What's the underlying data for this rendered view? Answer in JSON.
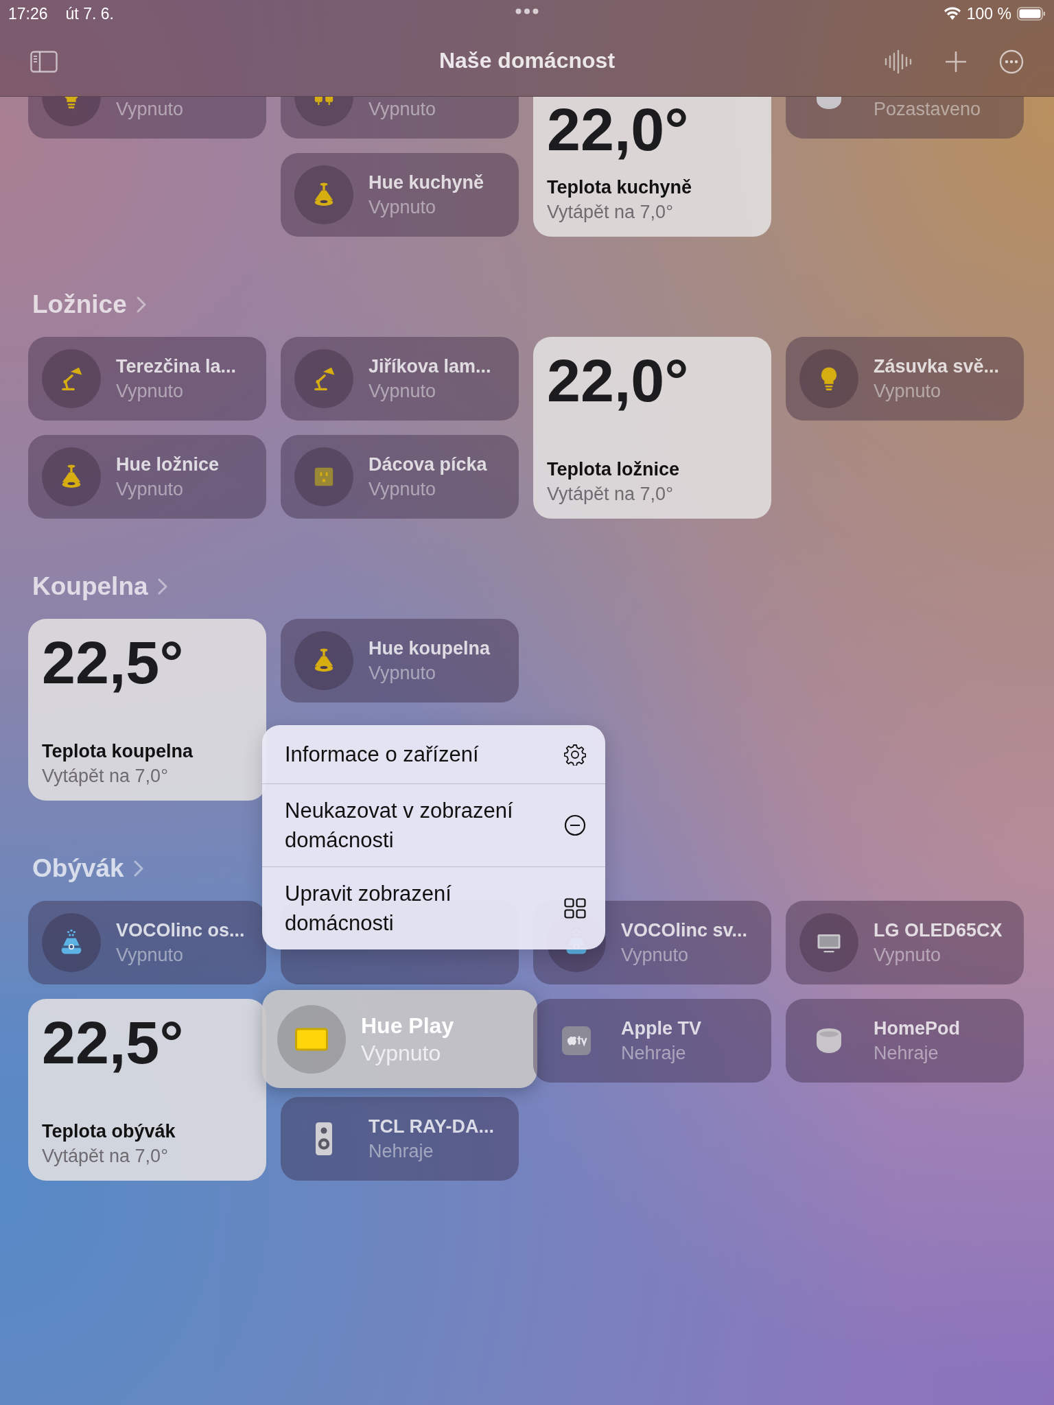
{
  "status_bar": {
    "time": "17:26",
    "date": "út 7. 6.",
    "battery": "100 %"
  },
  "nav_bar": {
    "title": "Naše domácnost"
  },
  "sections": [
    {
      "columns": [
        [
          {
            "kind": "bulb",
            "status": "Vypnuto",
            "selected": false
          }
        ],
        [
          {
            "kind": "powerstrip",
            "status": "Vypnuto",
            "selected": false
          },
          {
            "kind": "pendant",
            "name": "Hue kuchyně",
            "status": "Vypnuto",
            "selected": false
          }
        ],
        [
          {
            "kind": "thermostat",
            "temperature": "22,0°",
            "name": "Teplota kuchyně",
            "status": "Vytápět na 7,0°",
            "selected": false
          }
        ],
        [
          {
            "kind": "homepod",
            "status": "Pozastaveno",
            "selected": false
          }
        ]
      ]
    },
    {
      "title": "Ložnice",
      "columns": [
        [
          {
            "kind": "desklamp",
            "name": "Terezčina la...",
            "status": "Vypnuto",
            "selected": false
          },
          {
            "kind": "pendant",
            "name": "Hue ložnice",
            "status": "Vypnuto",
            "selected": false
          }
        ],
        [
          {
            "kind": "desklamp",
            "name": "Jiříkova lam...",
            "status": "Vypnuto",
            "selected": false
          },
          {
            "kind": "outlet",
            "name": "Dácova pícka",
            "status": "Vypnuto",
            "selected": false
          }
        ],
        [
          {
            "kind": "thermostat",
            "temperature": "22,0°",
            "name": "Teplota ložnice",
            "status": "Vytápět na 7,0°",
            "selected": false
          }
        ],
        [
          {
            "kind": "bulb",
            "name": "Zásuvka svě...",
            "status": "Vypnuto",
            "selected": false
          }
        ]
      ]
    },
    {
      "title": "Koupelna",
      "columns": [
        [
          {
            "kind": "thermostat",
            "temperature": "22,5°",
            "name": "Teplota koupelna",
            "status": "Vytápět na 7,0°",
            "selected": false
          }
        ],
        [
          {
            "kind": "pendant",
            "name": "Hue koupelna",
            "status": "Vypnuto",
            "selected": false
          }
        ]
      ]
    },
    {
      "title": "Obývák",
      "columns": [
        [
          {
            "kind": "humidifier",
            "name": "VOCOlinc os...",
            "status": "Vypnuto",
            "selected": false
          },
          {
            "kind": "thermostat",
            "temperature": "22,5°",
            "name": "Teplota obývák",
            "status": "Vytápět na 7,0°",
            "selected": false
          }
        ],
        [
          {
            "kind": "covered",
            "selected": false
          },
          {
            "kind": "lightstrip",
            "name": "Hue Play",
            "status": "Vypnuto",
            "selected": true
          },
          {
            "kind": "speaker",
            "name": "TCL RAY-DA...",
            "status": "Nehraje",
            "selected": false
          }
        ],
        [
          {
            "kind": "humidifier",
            "name": "VOCOlinc sv...",
            "status": "Vypnuto",
            "selected": false
          },
          {
            "kind": "appletv",
            "name": "Apple TV",
            "status": "Nehraje",
            "selected": false
          }
        ],
        [
          {
            "kind": "tv",
            "name": "LG OLED65CX",
            "status": "Vypnuto",
            "selected": false
          },
          {
            "kind": "homepod",
            "name": "HomePod",
            "status": "Nehraje",
            "selected": false
          }
        ]
      ],
      "context_menu": {
        "items": [
          {
            "kind": "info",
            "label": "Informace o zařízení"
          },
          {
            "kind": "hide",
            "label": "Neukazovat v zobrazení domácnosti"
          },
          {
            "kind": "edit",
            "label": "Upravit zobrazení domácnosti"
          }
        ]
      }
    }
  ]
}
